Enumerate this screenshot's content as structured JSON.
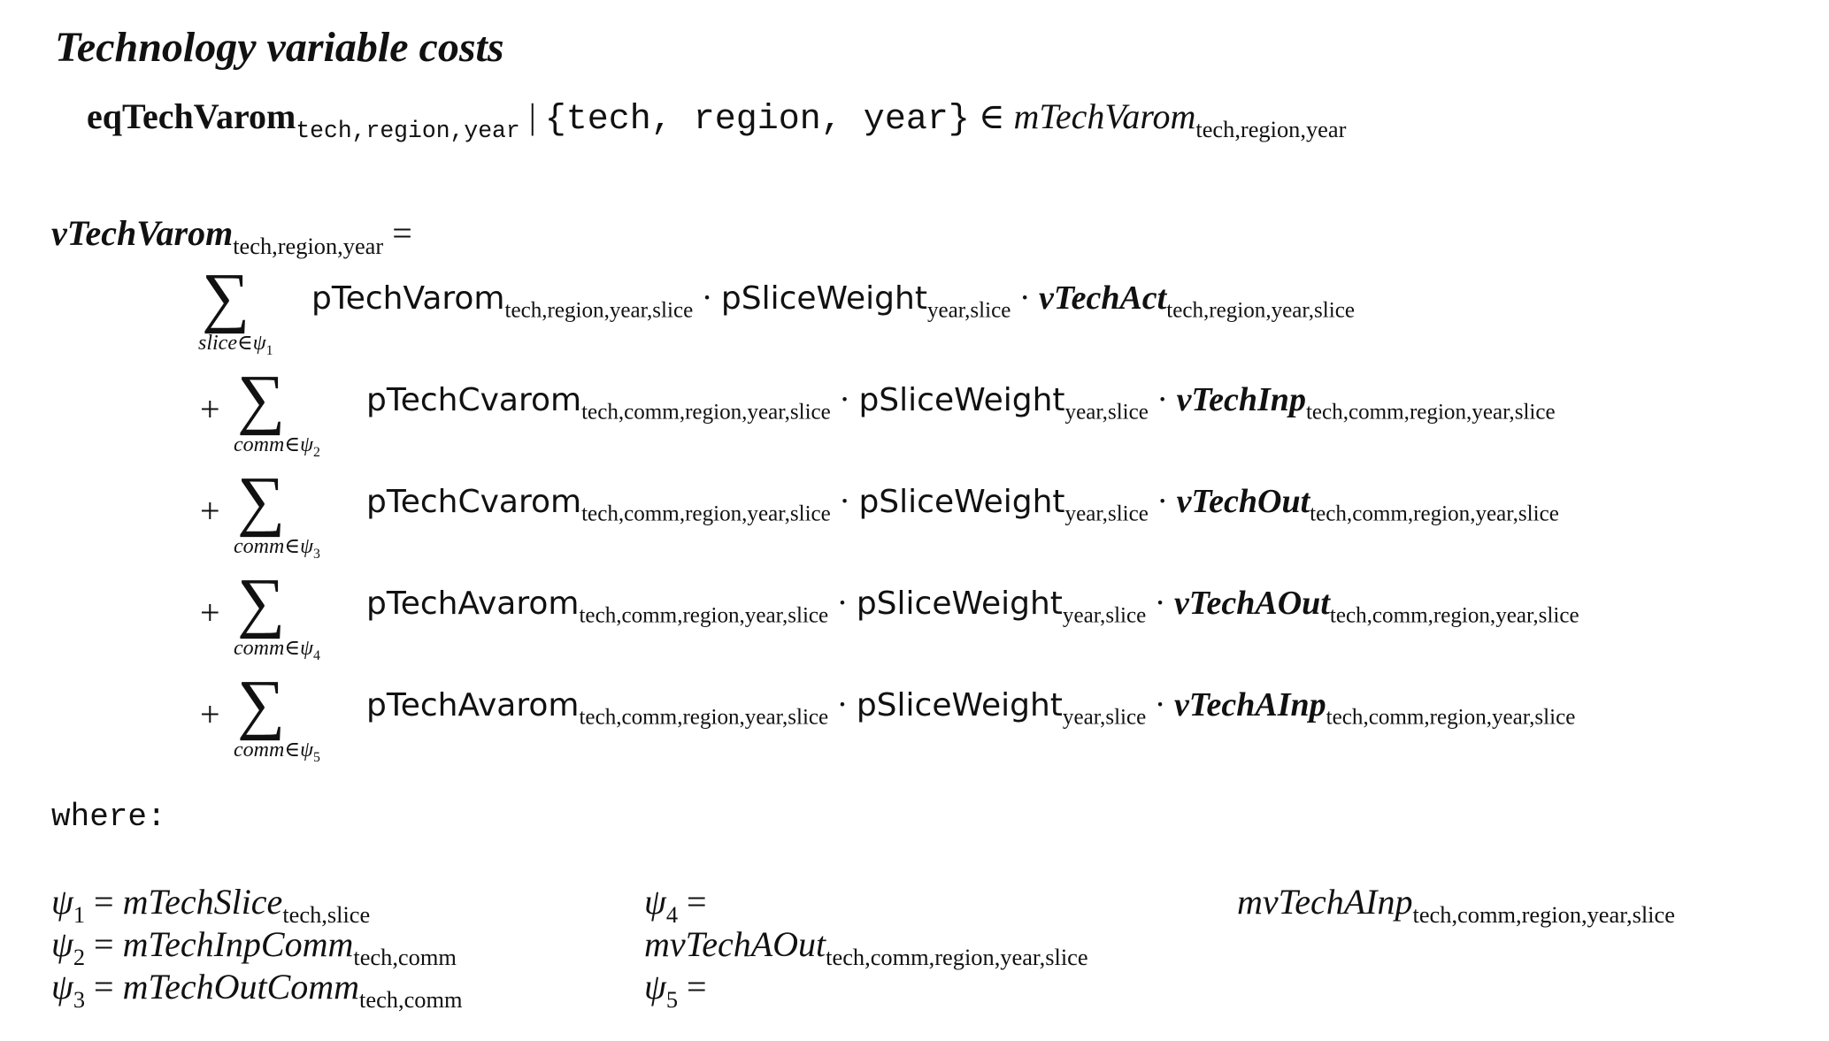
{
  "title": "Technology variable costs",
  "header": {
    "eq_name": "eqTechVarom",
    "eq_index": "tech,region,year",
    "condition": "{tech, region, year}",
    "set_name": "mTechVarom",
    "set_index": "tech,region,year"
  },
  "lhs": {
    "var": "vTechVarom",
    "index": "tech,region,year",
    "eq": "="
  },
  "terms": [
    {
      "op": "",
      "sum_index": "slice",
      "sum_set": "ψ",
      "sum_sub": "1",
      "param": "pTechVarom",
      "param_index": "tech,region,year,slice",
      "weight": "pSliceWeight",
      "weight_index": "year,slice",
      "var": "vTechAct",
      "var_index": "tech,region,year,slice"
    },
    {
      "op": "+",
      "sum_index": "comm",
      "sum_set": "ψ",
      "sum_sub": "2",
      "param": "pTechCvarom",
      "param_index": "tech,comm,region,year,slice",
      "weight": "pSliceWeight",
      "weight_index": "year,slice",
      "var": "vTechInp",
      "var_index": "tech,comm,region,year,slice"
    },
    {
      "op": "+",
      "sum_index": "comm",
      "sum_set": "ψ",
      "sum_sub": "3",
      "param": "pTechCvarom",
      "param_index": "tech,comm,region,year,slice",
      "weight": "pSliceWeight",
      "weight_index": "year,slice",
      "var": "vTechOut",
      "var_index": "tech,comm,region,year,slice"
    },
    {
      "op": "+",
      "sum_index": "comm",
      "sum_set": "ψ",
      "sum_sub": "4",
      "param": "pTechAvarom",
      "param_index": "tech,comm,region,year,slice",
      "weight": "pSliceWeight",
      "weight_index": "year,slice",
      "var": "vTechAOut",
      "var_index": "tech,comm,region,year,slice"
    },
    {
      "op": "+",
      "sum_index": "comm",
      "sum_set": "ψ",
      "sum_sub": "5",
      "param": "pTechAvarom",
      "param_index": "tech,comm,region,year,slice",
      "weight": "pSliceWeight",
      "weight_index": "year,slice",
      "var": "vTechAInp",
      "var_index": "tech,comm,region,year,slice"
    }
  ],
  "where_label": "where:",
  "definitions": [
    {
      "sym": "ψ",
      "sub": "1",
      "set": "mTechSlice",
      "index": "tech,slice"
    },
    {
      "sym": "ψ",
      "sub": "2",
      "set": "mTechInpComm",
      "index": "tech,comm"
    },
    {
      "sym": "ψ",
      "sub": "3",
      "set": "mTechOutComm",
      "index": "tech,comm"
    },
    {
      "sym": "ψ",
      "sub": "4",
      "set": "mvTechAInp",
      "index": "tech,comm,region,year,slice"
    },
    {
      "sym": "ψ",
      "sub": "5",
      "set": "mvTechAOut",
      "index": "tech,comm,region,year,slice"
    }
  ],
  "symbols": {
    "in": "∈",
    "bar": "|",
    "sum": "∑",
    "dot": "·"
  }
}
